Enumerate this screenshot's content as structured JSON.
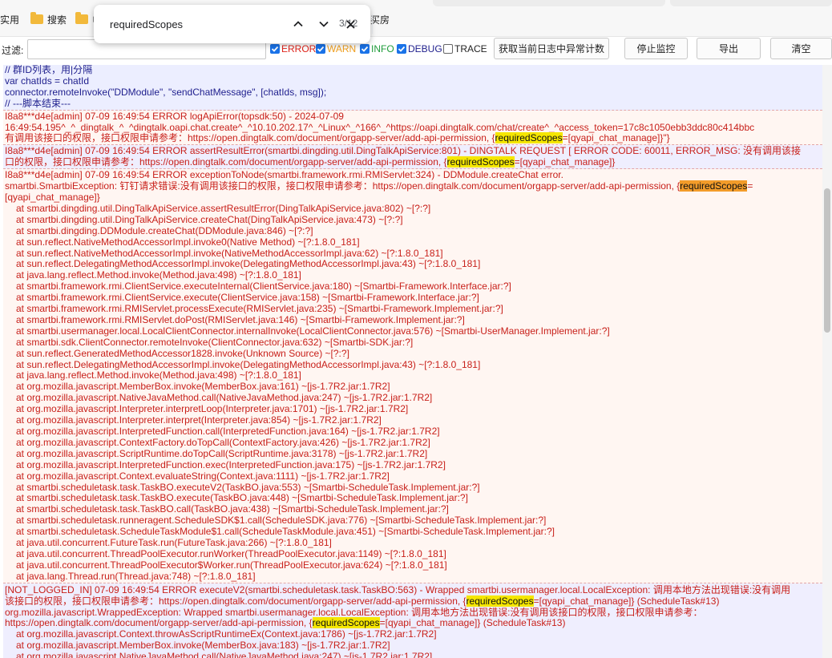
{
  "bookmarks": {
    "items": [
      {
        "label": "实用"
      },
      {
        "label": "搜索"
      },
      {
        "label": "电"
      },
      {
        "label": "买房"
      }
    ]
  },
  "findbar": {
    "query": "requiredScopes",
    "count": "3/12"
  },
  "toolbar": {
    "filter_label": "过滤:",
    "filter_value": "",
    "levels": [
      {
        "label": "ERROR",
        "checked": true,
        "color": "#e0241b"
      },
      {
        "label": "WARN",
        "checked": true,
        "color": "#f0a020"
      },
      {
        "label": "INFO",
        "checked": true,
        "color": "#1f9c3a"
      },
      {
        "label": "DEBUG",
        "checked": true,
        "color": "#1d1d8c"
      },
      {
        "label": "TRACE",
        "checked": false,
        "color": "#222222"
      }
    ],
    "buttons": {
      "count_label": "获取当前日志中异常计数",
      "stop_label": "停止监控",
      "export_label": "导出",
      "clear_label": "清空"
    }
  },
  "log": {
    "script": [
      "// 群ID列表，用|分隔",
      "var chatIds = chatId",
      "connector.remoteInvoke(\"DDModule\", \"sendChatMessage\", [chatIds, msg]);",
      "// ---脚本结束---"
    ],
    "entry1": {
      "l1": "I8a8***d4e[admin] 07-09 16:49:54 ERROR logApiError(topsdk:50) - 2024-07-09",
      "l2": "16:49:54.195^_^_dingtalk_^_^dingtalk.oapi.chat.create^_^10.10.202.17^_^Linux^_^166^_^https://oapi.dingtalk.com/chat/create^_^access_token=17c8c1050ebb3ddc80c414bbc",
      "l3_pre": "有调用该接口的权限，接口权限申请参考：https://open.dingtalk.com/document/orgapp-server/add-api-permission, {",
      "l3_post": "=[qyapi_chat_manage]}\"}"
    },
    "entry2": {
      "l1": "I8a8***d4e[admin] 07-09 16:49:54 ERROR assertResultError(smartbi.dingding.util.DingTalkApiService:801) - DINGTALK REQUEST [ ERROR CODE: 60011, ERROR_MSG: 没有调用该接",
      "l2_pre": "口的权限，接口权限申请参考：https://open.dingtalk.com/document/orgapp-server/add-api-permission, {",
      "l2_post": "=[qyapi_chat_manage]}"
    },
    "entry3": {
      "l1": "I8a8***d4e[admin] 07-09 16:49:54 ERROR exceptionToNode(smartbi.framework.rmi.RMIServlet:324) - DDModule.createChat error.",
      "l2_pre": "smartbi.SmartbiException: 钉钉请求错误:没有调用该接口的权限，接口权限申请参考：https://open.dingtalk.com/document/orgapp-server/add-api-permission, {",
      "l2_post": "=",
      "l3": "[qyapi_chat_manage]}",
      "trace": [
        "at smartbi.dingding.util.DingTalkApiService.assertResultError(DingTalkApiService.java:802) ~[?:?]",
        "at smartbi.dingding.util.DingTalkApiService.createChat(DingTalkApiService.java:473) ~[?:?]",
        "at smartbi.dingding.DDModule.createChat(DDModule.java:846) ~[?:?]",
        "at sun.reflect.NativeMethodAccessorImpl.invoke0(Native Method) ~[?:1.8.0_181]",
        "at sun.reflect.NativeMethodAccessorImpl.invoke(NativeMethodAccessorImpl.java:62) ~[?:1.8.0_181]",
        "at sun.reflect.DelegatingMethodAccessorImpl.invoke(DelegatingMethodAccessorImpl.java:43) ~[?:1.8.0_181]",
        "at java.lang.reflect.Method.invoke(Method.java:498) ~[?:1.8.0_181]",
        "at smartbi.framework.rmi.ClientService.executeInternal(ClientService.java:180) ~[Smartbi-Framework.Interface.jar:?]",
        "at smartbi.framework.rmi.ClientService.execute(ClientService.java:158) ~[Smartbi-Framework.Interface.jar:?]",
        "at smartbi.framework.rmi.RMIServlet.processExecute(RMIServlet.java:235) ~[Smartbi-Framework.Implement.jar:?]",
        "at smartbi.framework.rmi.RMIServlet.doPost(RMIServlet.java:146) ~[Smartbi-Framework.Implement.jar:?]",
        "at smartbi.usermanager.local.LocalClientConnector.internalInvoke(LocalClientConnector.java:576) ~[Smartbi-UserManager.Implement.jar:?]",
        "at smartbi.sdk.ClientConnector.remoteInvoke(ClientConnector.java:632) ~[Smartbi-SDK.jar:?]",
        "at sun.reflect.GeneratedMethodAccessor1828.invoke(Unknown Source) ~[?:?]",
        "at sun.reflect.DelegatingMethodAccessorImpl.invoke(DelegatingMethodAccessorImpl.java:43) ~[?:1.8.0_181]",
        "at java.lang.reflect.Method.invoke(Method.java:498) ~[?:1.8.0_181]",
        "at org.mozilla.javascript.MemberBox.invoke(MemberBox.java:161) ~[js-1.7R2.jar:1.7R2]",
        "at org.mozilla.javascript.NativeJavaMethod.call(NativeJavaMethod.java:247) ~[js-1.7R2.jar:1.7R2]",
        "at org.mozilla.javascript.Interpreter.interpretLoop(Interpreter.java:1701) ~[js-1.7R2.jar:1.7R2]",
        "at org.mozilla.javascript.Interpreter.interpret(Interpreter.java:854) ~[js-1.7R2.jar:1.7R2]",
        "at org.mozilla.javascript.InterpretedFunction.call(InterpretedFunction.java:164) ~[js-1.7R2.jar:1.7R2]",
        "at org.mozilla.javascript.ContextFactory.doTopCall(ContextFactory.java:426) ~[js-1.7R2.jar:1.7R2]",
        "at org.mozilla.javascript.ScriptRuntime.doTopCall(ScriptRuntime.java:3178) ~[js-1.7R2.jar:1.7R2]",
        "at org.mozilla.javascript.InterpretedFunction.exec(InterpretedFunction.java:175) ~[js-1.7R2.jar:1.7R2]",
        "at org.mozilla.javascript.Context.evaluateString(Context.java:1111) ~[js-1.7R2.jar:1.7R2]",
        "at smartbi.scheduletask.task.TaskBO.executeV2(TaskBO.java:553) ~[Smartbi-ScheduleTask.Implement.jar:?]",
        "at smartbi.scheduletask.task.TaskBO.execute(TaskBO.java:448) ~[Smartbi-ScheduleTask.Implement.jar:?]",
        "at smartbi.scheduletask.task.TaskBO.call(TaskBO.java:438) ~[Smartbi-ScheduleTask.Implement.jar:?]",
        "at smartbi.scheduletask.runneragent.ScheduleSDK$1.call(ScheduleSDK.java:776) ~[Smartbi-ScheduleTask.Implement.jar:?]",
        "at smartbi.scheduletask.ScheduleTaskModule$1.call(ScheduleTaskModule.java:451) ~[Smartbi-ScheduleTask.Implement.jar:?]",
        "at java.util.concurrent.FutureTask.run(FutureTask.java:266) ~[?:1.8.0_181]",
        "at java.util.concurrent.ThreadPoolExecutor.runWorker(ThreadPoolExecutor.java:1149) ~[?:1.8.0_181]",
        "at java.util.concurrent.ThreadPoolExecutor$Worker.run(ThreadPoolExecutor.java:624) ~[?:1.8.0_181]",
        "at java.lang.Thread.run(Thread.java:748) ~[?:1.8.0_181]"
      ]
    },
    "entry4": {
      "l1": "[NOT_LOGGED_IN] 07-09 16:49:54 ERROR executeV2(smartbi.scheduletask.task.TaskBO:563) - Wrapped smartbi.usermanager.local.LocalException: 调用本地方法出现错误:没有调用",
      "l2_pre": "该接口的权限，接口权限申请参考：https://open.dingtalk.com/document/orgapp-server/add-api-permission, {",
      "l2_post": "=[qyapi_chat_manage]} (ScheduleTask#13)",
      "l3": "org.mozilla.javascript.WrappedException: Wrapped smartbi.usermanager.local.LocalException: 调用本地方法出现错误:没有调用该接口的权限，接口权限申请参考：",
      "l4_pre": "https://open.dingtalk.com/document/orgapp-server/add-api-permission, {",
      "l4_post": "=[qyapi_chat_manage]} (ScheduleTask#13)",
      "trace": [
        "at org.mozilla.javascript.Context.throwAsScriptRuntimeEx(Context.java:1786) ~[js-1.7R2.jar:1.7R2]",
        "at org.mozilla.javascript.MemberBox.invoke(MemberBox.java:183) ~[js-1.7R2.jar:1.7R2]",
        "at org.mozilla.javascript.NativeJavaMethod.call(NativeJavaMethod.java:247) ~[js-1.7R2.jar:1.7R2]"
      ]
    },
    "highlight_word": "requiredScopes"
  }
}
